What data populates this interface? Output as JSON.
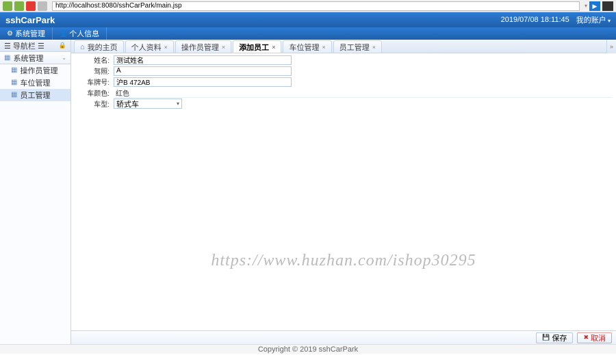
{
  "browser": {
    "url": "http://localhost:8080/sshCarPark/main.jsp"
  },
  "header": {
    "app_title": "sshCarPark",
    "timestamp": "2019/07/08 18:11:45",
    "account_label": "我的账户"
  },
  "top_menu": {
    "system": "系统管理",
    "profile": "个人信息"
  },
  "sidebar": {
    "nav_title": "☰ 导航栏 ☰",
    "group_label": "系统管理",
    "items": [
      {
        "label": "操作员管理",
        "selected": false
      },
      {
        "label": "车位管理",
        "selected": false
      },
      {
        "label": "员工管理",
        "selected": true
      }
    ]
  },
  "tabs": [
    {
      "label": "我的主页",
      "home": true,
      "closable": false,
      "active": false
    },
    {
      "label": "个人资料",
      "closable": true,
      "active": false
    },
    {
      "label": "操作员管理",
      "closable": true,
      "active": false
    },
    {
      "label": "添加员工",
      "closable": true,
      "active": true
    },
    {
      "label": "车位管理",
      "closable": true,
      "active": false
    },
    {
      "label": "员工管理",
      "closable": true,
      "active": false
    }
  ],
  "form": {
    "fields": {
      "name_label": "姓名:",
      "name_value": "测试姓名",
      "license_label": "驾照:",
      "license_value": "A",
      "plate_label": "车牌号:",
      "plate_value": "沪B 472AB",
      "color_label": "车颜色:",
      "color_value": "红色",
      "type_label": "车型:",
      "type_value": "轿式车"
    }
  },
  "buttons": {
    "save": "保存",
    "cancel": "取消"
  },
  "footer": {
    "copyright": "Copyright © 2019 sshCarPark"
  },
  "watermark": "https://www.huzhan.com/ishop30295"
}
